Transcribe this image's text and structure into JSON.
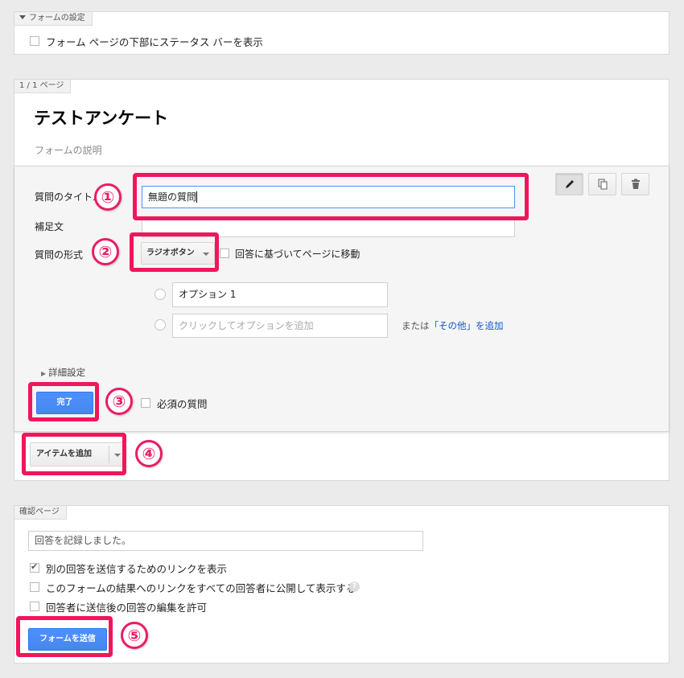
{
  "form_settings": {
    "header": "フォームの設定",
    "show_progress_label": "フォーム ページの下部にステータス バーを表示"
  },
  "page": {
    "tab_label": "1 / 1 ページ",
    "title": "テストアンケート",
    "description_placeholder": "フォームの説明"
  },
  "question": {
    "title_label": "質問のタイトル",
    "title_value": "無題の質問",
    "help_label": "補足文",
    "type_label": "質問の形式",
    "type_value": "ラジオボタン",
    "go_to_page_label": "回答に基づいてページに移動",
    "option1": "オプション 1",
    "add_option_placeholder": "クリックしてオプションを追加",
    "or_text": "または",
    "add_other_link": "「その他」を追加",
    "advanced_label": "詳細設定",
    "done_button": "完了",
    "required_label": "必須の質問",
    "tool_icons": [
      "pencil-icon",
      "copy-icon",
      "trash-icon"
    ]
  },
  "add_item": {
    "label": "アイテムを追加"
  },
  "confirmation": {
    "tab_label": "確認ページ",
    "message": "回答を記録しました。",
    "options": [
      {
        "label": "別の回答を送信するためのリンクを表示",
        "checked": true
      },
      {
        "label": "このフォームの結果へのリンクをすべての回答者に公開して表示する",
        "checked": false
      },
      {
        "label": "回答者に送信後の回答の編集を許可",
        "checked": false
      }
    ],
    "help_icon": "?",
    "send_button": "フォームを送信"
  },
  "callouts": [
    "①",
    "②",
    "③",
    "④",
    "⑤"
  ],
  "colors": {
    "highlight": "#f0165c",
    "primary_button": "#4d90fe",
    "link": "#1155cc"
  }
}
